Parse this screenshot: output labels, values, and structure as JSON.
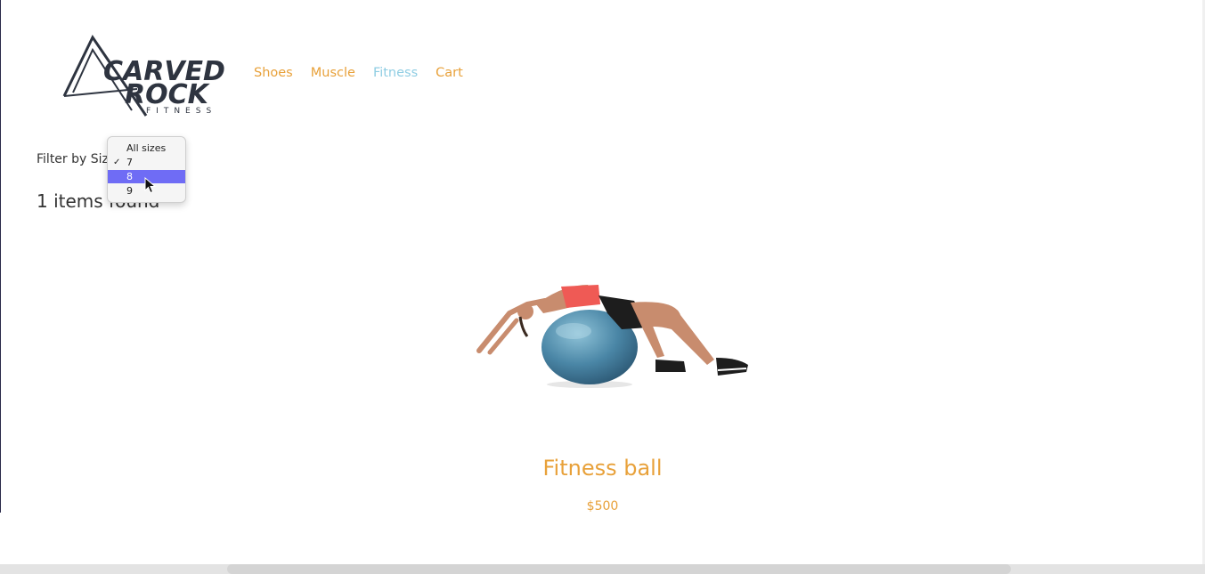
{
  "brand": {
    "logo_text_top": "CARVED",
    "logo_text_mid": "ROCK",
    "logo_text_sub": "FITNESS"
  },
  "nav": [
    {
      "label": "Shoes",
      "active": false
    },
    {
      "label": "Muscle",
      "active": false
    },
    {
      "label": "Fitness",
      "active": true
    },
    {
      "label": "Cart",
      "active": false
    }
  ],
  "filter": {
    "label": "Filter by Size:",
    "options": [
      "All sizes",
      "7",
      "8",
      "9"
    ],
    "checked": "7",
    "highlighted": "8"
  },
  "results": {
    "count_text": "1 items found"
  },
  "product": {
    "name": "Fitness ball",
    "price": "$500"
  },
  "colors": {
    "accent": "#e8a13a",
    "active_nav": "#8fcde3",
    "highlight": "#6f6cf5"
  }
}
